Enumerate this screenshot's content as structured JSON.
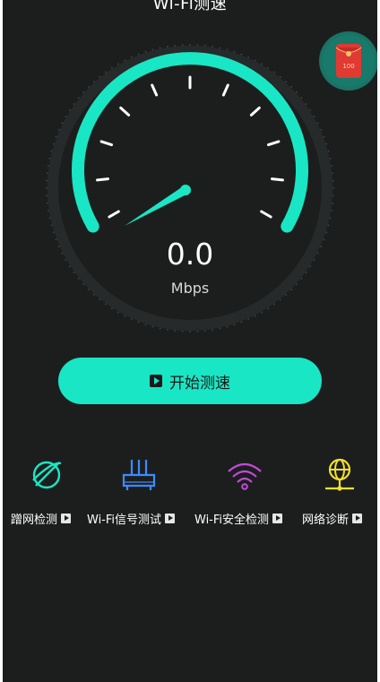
{
  "header": {
    "title": "Wi-Fi测速"
  },
  "gauge": {
    "speed_value": "0.0",
    "unit": "Mbps",
    "needle_level": 0
  },
  "start_button": {
    "label": "开始测速",
    "icon": "play-icon"
  },
  "tools": [
    {
      "label": "蹭网检测",
      "icon": "planet-icon",
      "color": "#19e6c4"
    },
    {
      "label": "Wi-Fi信号测试",
      "icon": "router-icon",
      "color": "#3d8bff"
    },
    {
      "label": "Wi-Fi安全检测",
      "icon": "wifi-icon",
      "color": "#c34ad9"
    },
    {
      "label": "网络诊断",
      "icon": "globe-network-icon",
      "color": "#f2e02a"
    }
  ],
  "colors": {
    "accent": "#19e6c4",
    "background": "#1c1e1e",
    "red_packet": "#d9302c"
  },
  "red_packet": {
    "text": "100"
  }
}
